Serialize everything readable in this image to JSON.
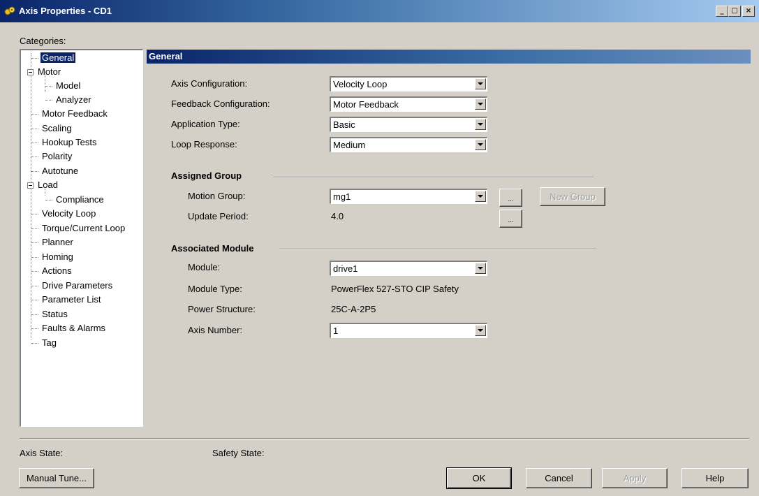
{
  "window": {
    "title": "Axis Properties - CD1",
    "controls": {
      "minimize": "_",
      "maximize": "□",
      "close": "×"
    }
  },
  "categories": {
    "label": "Categories:",
    "items": [
      {
        "label": "General",
        "selected": true
      },
      {
        "label": "Motor",
        "expandable": true
      },
      {
        "label": "Model"
      },
      {
        "label": "Analyzer"
      },
      {
        "label": "Motor Feedback"
      },
      {
        "label": "Scaling"
      },
      {
        "label": "Hookup Tests"
      },
      {
        "label": "Polarity"
      },
      {
        "label": "Autotune"
      },
      {
        "label": "Load",
        "expandable": true
      },
      {
        "label": "Compliance"
      },
      {
        "label": "Velocity Loop"
      },
      {
        "label": "Torque/Current Loop"
      },
      {
        "label": "Planner"
      },
      {
        "label": "Homing"
      },
      {
        "label": "Actions"
      },
      {
        "label": "Drive Parameters"
      },
      {
        "label": "Parameter List"
      },
      {
        "label": "Status"
      },
      {
        "label": "Faults & Alarms"
      },
      {
        "label": "Tag"
      }
    ]
  },
  "general": {
    "header": "General",
    "axis_configuration": {
      "label": "Axis Configuration:",
      "value": "Velocity Loop"
    },
    "feedback_configuration": {
      "label": "Feedback Configuration:",
      "value": "Motor Feedback"
    },
    "application_type": {
      "label": "Application Type:",
      "value": "Basic"
    },
    "loop_response": {
      "label": "Loop Response:",
      "value": "Medium"
    }
  },
  "assigned_group": {
    "title": "Assigned Group",
    "motion_group": {
      "label": "Motion Group:",
      "value": "mg1"
    },
    "update_period": {
      "label": "Update Period:",
      "value": "4.0"
    },
    "browse_label": "...",
    "new_group_label": "New Group"
  },
  "associated_module": {
    "title": "Associated Module",
    "module": {
      "label": "Module:",
      "value": "drive1"
    },
    "module_type": {
      "label": "Module Type:",
      "value": "PowerFlex 527-STO CIP Safety"
    },
    "power_structure": {
      "label": "Power Structure:",
      "value": "25C-A-2P5"
    },
    "axis_number": {
      "label": "Axis Number:",
      "value": "1"
    }
  },
  "status": {
    "axis_state_label": "Axis State:",
    "safety_state_label": "Safety State:"
  },
  "buttons": {
    "manual_tune": "Manual Tune...",
    "ok": "OK",
    "cancel": "Cancel",
    "apply": "Apply",
    "help": "Help"
  },
  "colors": {
    "title_bar": "#0a246a",
    "section_header": "#0a246a",
    "selection": "#0a246a",
    "face": "#d4d0c8"
  }
}
